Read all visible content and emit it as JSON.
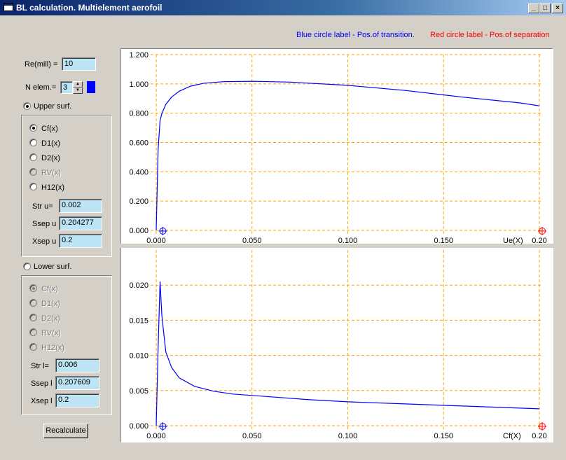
{
  "window": {
    "title": "BL calculation. Multielement aerofoil",
    "controls": [
      "_",
      "□",
      "×"
    ]
  },
  "legend": {
    "blue_text": "Blue circle label - Pos.of transition.",
    "red_text": "Red circle label - Pos.of separation",
    "blue_color": "#0000ff",
    "red_color": "#ff0000"
  },
  "left_panel": {
    "re_label": "Re(mill) =",
    "re_value": "10",
    "nelem_label": "N elem.=",
    "nelem_value": "3",
    "color_swatch": "#0000ff",
    "upper": {
      "label": "Upper surf.",
      "selected": true,
      "options": [
        {
          "label": "Cf(x)",
          "checked": true,
          "enabled": true
        },
        {
          "label": "D1(x)",
          "checked": false,
          "enabled": true
        },
        {
          "label": "D2(x)",
          "checked": false,
          "enabled": true
        },
        {
          "label": "RV(x)",
          "checked": false,
          "enabled": false
        },
        {
          "label": "H12(x)",
          "checked": false,
          "enabled": true
        }
      ],
      "str_label": "Str u=",
      "str_value": "0.002",
      "ssep_label": "Ssep u",
      "ssep_value": "0.204277",
      "xsep_label": "Xsep u",
      "xsep_value": "0.2"
    },
    "lower": {
      "label": "Lower surf.",
      "selected": false,
      "options": [
        {
          "label": "Cf(x)",
          "checked": true,
          "enabled": false
        },
        {
          "label": "D1(x)",
          "checked": false,
          "enabled": false
        },
        {
          "label": "D2(x)",
          "checked": false,
          "enabled": false
        },
        {
          "label": "RV(x)",
          "checked": false,
          "enabled": false
        },
        {
          "label": "H12(x)",
          "checked": false,
          "enabled": false
        }
      ],
      "str_label": "Str l=",
      "str_value": "0.006",
      "ssep_label": "Ssep l",
      "ssep_value": "0.207609",
      "xsep_label": "Xsep l",
      "xsep_value": "0.2"
    },
    "recalculate_label": "Recalculate"
  },
  "chart_data": [
    {
      "type": "line",
      "xlabel": "Ue(X)",
      "ylabel": "",
      "xlim": [
        -0.004,
        0.2
      ],
      "ylim": [
        0,
        1.2
      ],
      "x_ticks": [
        "0.000",
        "0.050",
        "0.100",
        "0.150",
        "0.20"
      ],
      "y_ticks": [
        "0.000",
        "0.200",
        "0.400",
        "0.600",
        "0.800",
        "1.000",
        "1.200"
      ],
      "grid": true,
      "grid_color": "#ffa500",
      "line_color": "#0000ff",
      "x": [
        0.0,
        0.001,
        0.002,
        0.003,
        0.005,
        0.008,
        0.012,
        0.018,
        0.025,
        0.035,
        0.05,
        0.07,
        0.1,
        0.13,
        0.16,
        0.19,
        0.2
      ],
      "y": [
        0.0,
        0.55,
        0.75,
        0.8,
        0.86,
        0.91,
        0.95,
        0.985,
        1.005,
        1.015,
        1.018,
        1.012,
        0.99,
        0.955,
        0.91,
        0.87,
        0.85
      ],
      "transition_marker_x": 0.002,
      "separation_marker_x": 0.2
    },
    {
      "type": "line",
      "xlabel": "Cf(X)",
      "ylabel": "",
      "xlim": [
        -0.004,
        0.2
      ],
      "ylim": [
        0,
        0.025
      ],
      "x_ticks": [
        "0.000",
        "0.050",
        "0.100",
        "0.150",
        "0.20"
      ],
      "y_ticks": [
        "0.000",
        "0.005",
        "0.010",
        "0.015",
        "0.020"
      ],
      "grid": true,
      "grid_color": "#ffa500",
      "line_color": "#0000ff",
      "x": [
        0.0,
        0.001,
        0.002,
        0.003,
        0.005,
        0.008,
        0.012,
        0.02,
        0.03,
        0.04,
        0.06,
        0.08,
        0.1,
        0.13,
        0.16,
        0.2
      ],
      "y": [
        0.0,
        0.011,
        0.0205,
        0.0155,
        0.0105,
        0.0083,
        0.0068,
        0.0056,
        0.0049,
        0.0045,
        0.0041,
        0.0037,
        0.0034,
        0.0031,
        0.0028,
        0.0024
      ],
      "transition_marker_x": 0.002,
      "separation_marker_x": 0.2
    }
  ]
}
